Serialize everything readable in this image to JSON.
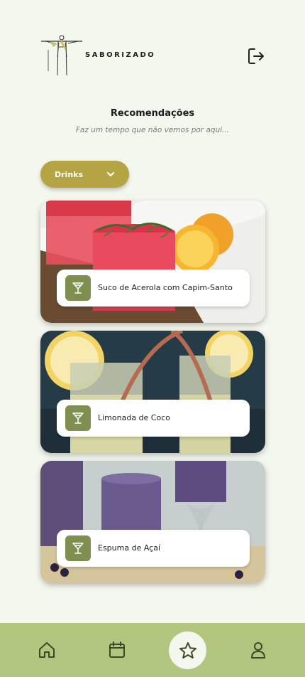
{
  "brand": {
    "name": "SABORIZADO"
  },
  "header": {
    "logout_icon": "logout-icon"
  },
  "page": {
    "title": "Recomendações",
    "subtitle": "Faz um tempo que não vemos por aqui..."
  },
  "filter": {
    "selected": "Drinks",
    "icon": "chevron-down-icon"
  },
  "cards": [
    {
      "name": "Suco de Acerola com Capim-Santo",
      "icon": "cocktail-icon"
    },
    {
      "name": "Limonada de Coco",
      "icon": "cocktail-icon"
    },
    {
      "name": "Espuma de Açaí",
      "icon": "cocktail-icon"
    }
  ],
  "nav": {
    "items": [
      {
        "icon": "home-icon"
      },
      {
        "icon": "calendar-icon"
      },
      {
        "icon": "star-icon",
        "active": true
      },
      {
        "icon": "user-icon"
      }
    ]
  },
  "colors": {
    "background": "#f4f7ee",
    "dropdown": "#b5a443",
    "nav_bar": "#b1c67f",
    "card_icon_bg": "#7f8f4f"
  }
}
